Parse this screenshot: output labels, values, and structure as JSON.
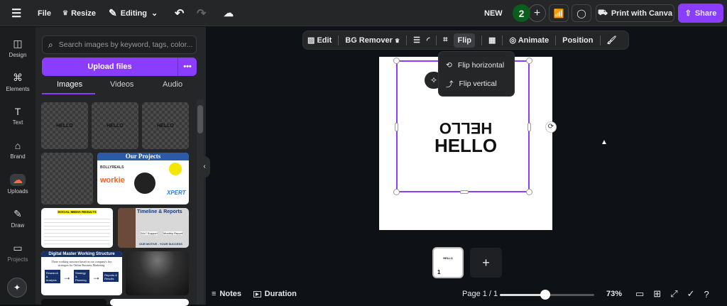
{
  "topbar": {
    "file": "File",
    "resize": "Resize",
    "editing": "Editing",
    "new": "NEW",
    "collaborator_badge": "2",
    "print": "Print with Canva",
    "share": "Share"
  },
  "rail": [
    {
      "label": "Design",
      "icon": "layout-icon"
    },
    {
      "label": "Elements",
      "icon": "shapes-icon"
    },
    {
      "label": "Text",
      "icon": "text-icon"
    },
    {
      "label": "Brand",
      "icon": "brand-icon"
    },
    {
      "label": "Uploads",
      "icon": "cloud-upload-icon"
    },
    {
      "label": "Draw",
      "icon": "pen-icon"
    },
    {
      "label": "Projects",
      "icon": "folder-icon"
    }
  ],
  "panel": {
    "search_placeholder": "Search images by keyword, tags, color...",
    "upload": "Upload files",
    "tabs": [
      "Images",
      "Videos",
      "Audio"
    ],
    "thumbs": {
      "hello": "HELLO",
      "projects": "Our Projects",
      "workie": "workie",
      "bollyreals": "BOLLYREALS",
      "xpert": "XPERT",
      "social": "SOCIAL MEDIA RESULTS",
      "timeline": "Timeline & Reports",
      "motive": "OUR MOTIVE - YOUR SUCCESS",
      "support": "24x7 Support",
      "monthly": "Monthly Report",
      "digital": "Digital Master Working Structure",
      "digital_desc": "These working structure based on our company's key strategies for Online Business Marketing.",
      "step1": "Research & Analysis",
      "step2": "Strategy & Planning",
      "step3": "Reports & Results"
    }
  },
  "toolbar": {
    "edit": "Edit",
    "bg_remover": "BG Remover",
    "flip": "Flip",
    "animate": "Animate",
    "position": "Position"
  },
  "flip_menu": {
    "horizontal": "Flip horizontal",
    "vertical": "Flip vertical"
  },
  "canvas": {
    "text_flipped": "HELLO",
    "text": "HELLO"
  },
  "pages": {
    "number": "1",
    "thumb_text": "HELLO"
  },
  "bottom": {
    "notes": "Notes",
    "duration": "Duration",
    "page": "Page 1 / 1",
    "zoom": "73%",
    "zoom_fraction": 0.48
  },
  "colors": {
    "accent": "#8b3dff",
    "badge": "#0b5d1e"
  }
}
